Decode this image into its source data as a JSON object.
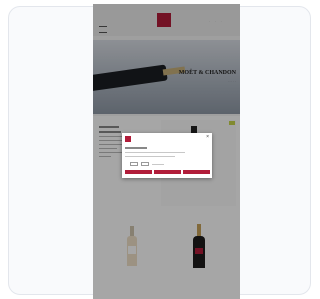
{
  "site": {
    "header_right": "· · ·",
    "hero_title": "MOËT & CHANDON",
    "hero_subtitle": "· · · · ·"
  },
  "age_gate": {
    "close_icon": "×"
  },
  "colors": {
    "brand": "#b11d3a",
    "overlay": "rgba(0,0,0,0.35)",
    "badge": "#c7d44a"
  }
}
